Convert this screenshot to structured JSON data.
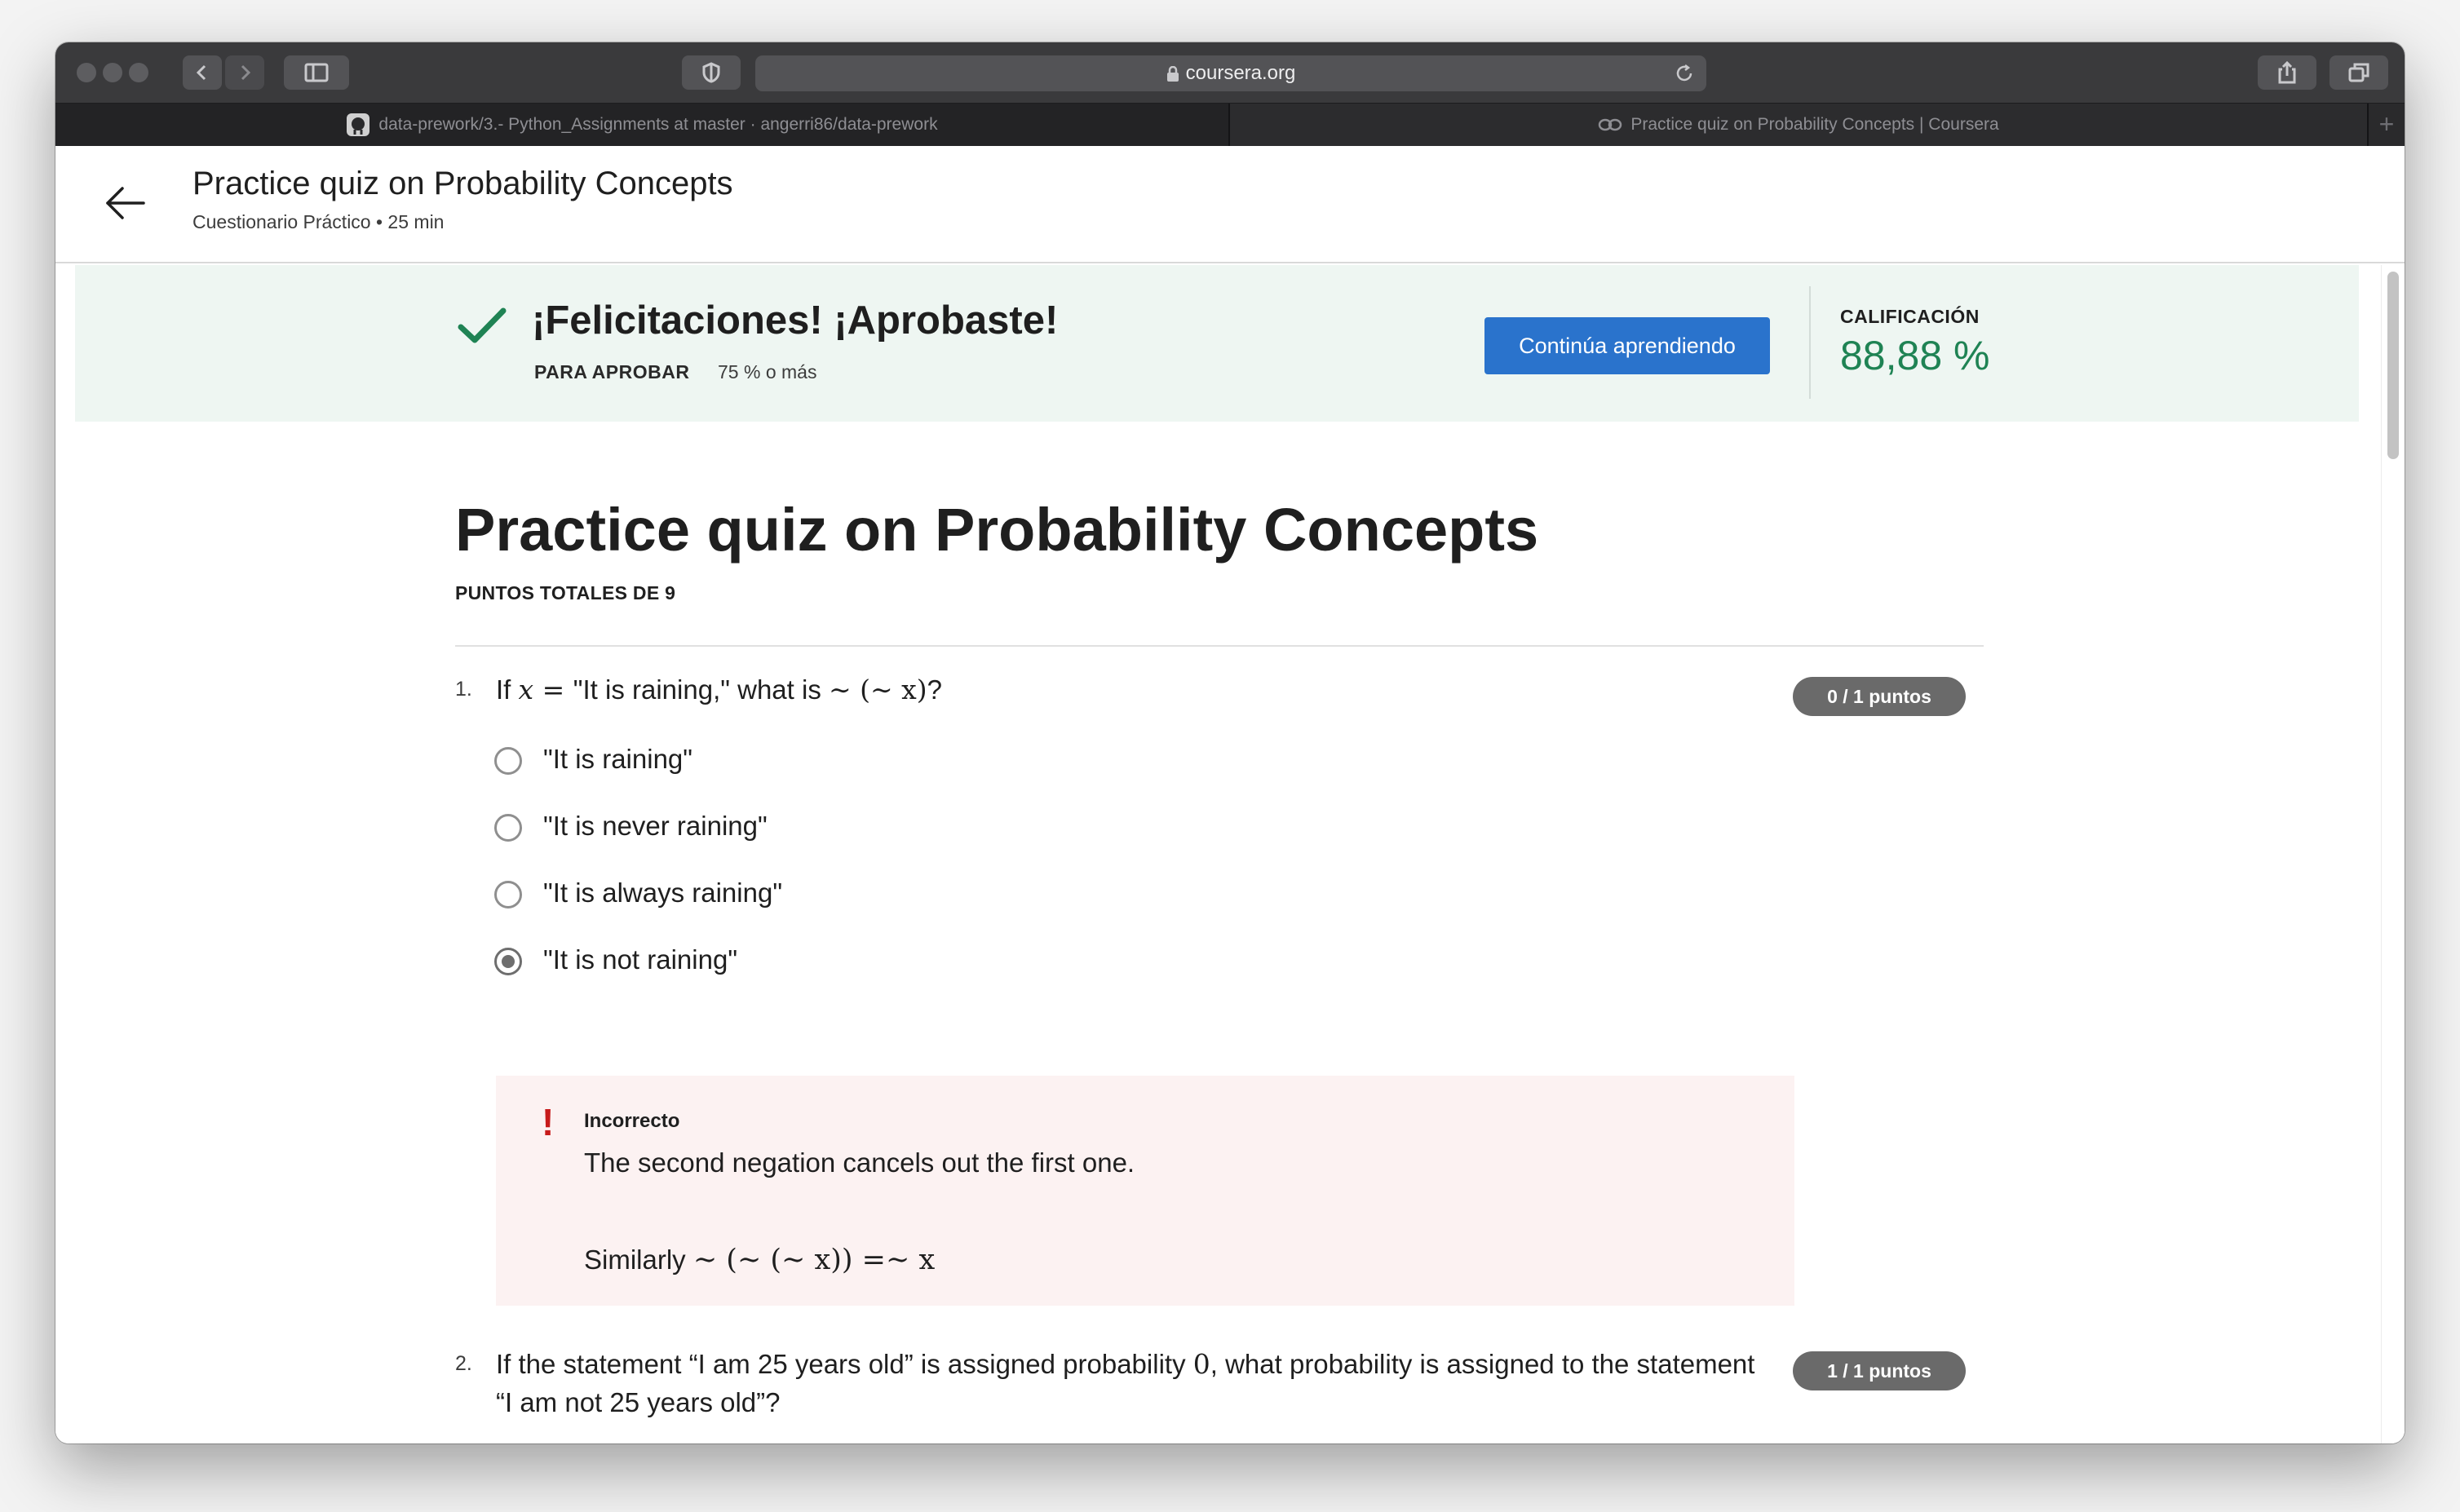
{
  "browser": {
    "url": "coursera.org",
    "tabs": [
      {
        "label": "data-prework/3.- Python_Assignments at master · angerri86/data-prework"
      },
      {
        "label": "Practice quiz on Probability Concepts | Coursera"
      }
    ],
    "new_tab_label": "+"
  },
  "header": {
    "title": "Practice quiz on Probability Concepts",
    "subtitle": "Cuestionario Práctico • 25 min"
  },
  "banner": {
    "title": "¡Felicitaciones! ¡Aprobaste!",
    "pass_label": "PARA APROBAR",
    "pass_value": "75 % o más",
    "continue_label": "Continúa aprendiendo",
    "grade_label": "CALIFICACIÓN",
    "grade_value": "88,88 %",
    "grade_color": "#1f8354"
  },
  "quiz": {
    "title": "Practice quiz on Probability Concepts",
    "points_total": "PUNTOS TOTALES DE 9",
    "questions": [
      {
        "number": "1.",
        "text_a": "If ",
        "math_x": "x",
        "text_eq": " = ",
        "text_b": "\"It is raining,\" what is ",
        "math_expr": "∼ (∼ x)",
        "text_c": "?",
        "score": "0 / 1 puntos",
        "options": [
          {
            "label": "\"It is raining\"",
            "selected": false
          },
          {
            "label": "\"It is never raining\"",
            "selected": false
          },
          {
            "label": "\"It is always raining\"",
            "selected": false
          },
          {
            "label": "\"It is not raining\"",
            "selected": true
          }
        ],
        "feedback": {
          "status": "Incorrecto",
          "icon": "!",
          "text": "The second negation cancels out the first one.",
          "similarly_label": "Similarly ",
          "similarly_math": "∼ (∼ (∼ x)) =∼ x"
        }
      },
      {
        "number": "2.",
        "text_a": "If the statement “I am 25 years old” is assigned probability ",
        "math_zero": "0",
        "text_b": ", what probability is assigned to the statement",
        "text_line2": "“I am not 25 years old”?",
        "score": "1 / 1 puntos"
      }
    ]
  },
  "colors": {
    "accent_button": "#2a73cc",
    "banner_bg": "#eef6f2",
    "feedback_bg": "#fcf2f2",
    "error_red": "#c71b1b",
    "success_green": "#1f8354"
  },
  "icons": [
    "back-arrow-icon",
    "checkmark-icon",
    "lock-icon",
    "reload-icon",
    "github-icon",
    "coursera-icon",
    "sidebar-icon",
    "shield-icon",
    "share-icon",
    "tabs-icon",
    "chevron-left-icon",
    "chevron-right-icon"
  ]
}
